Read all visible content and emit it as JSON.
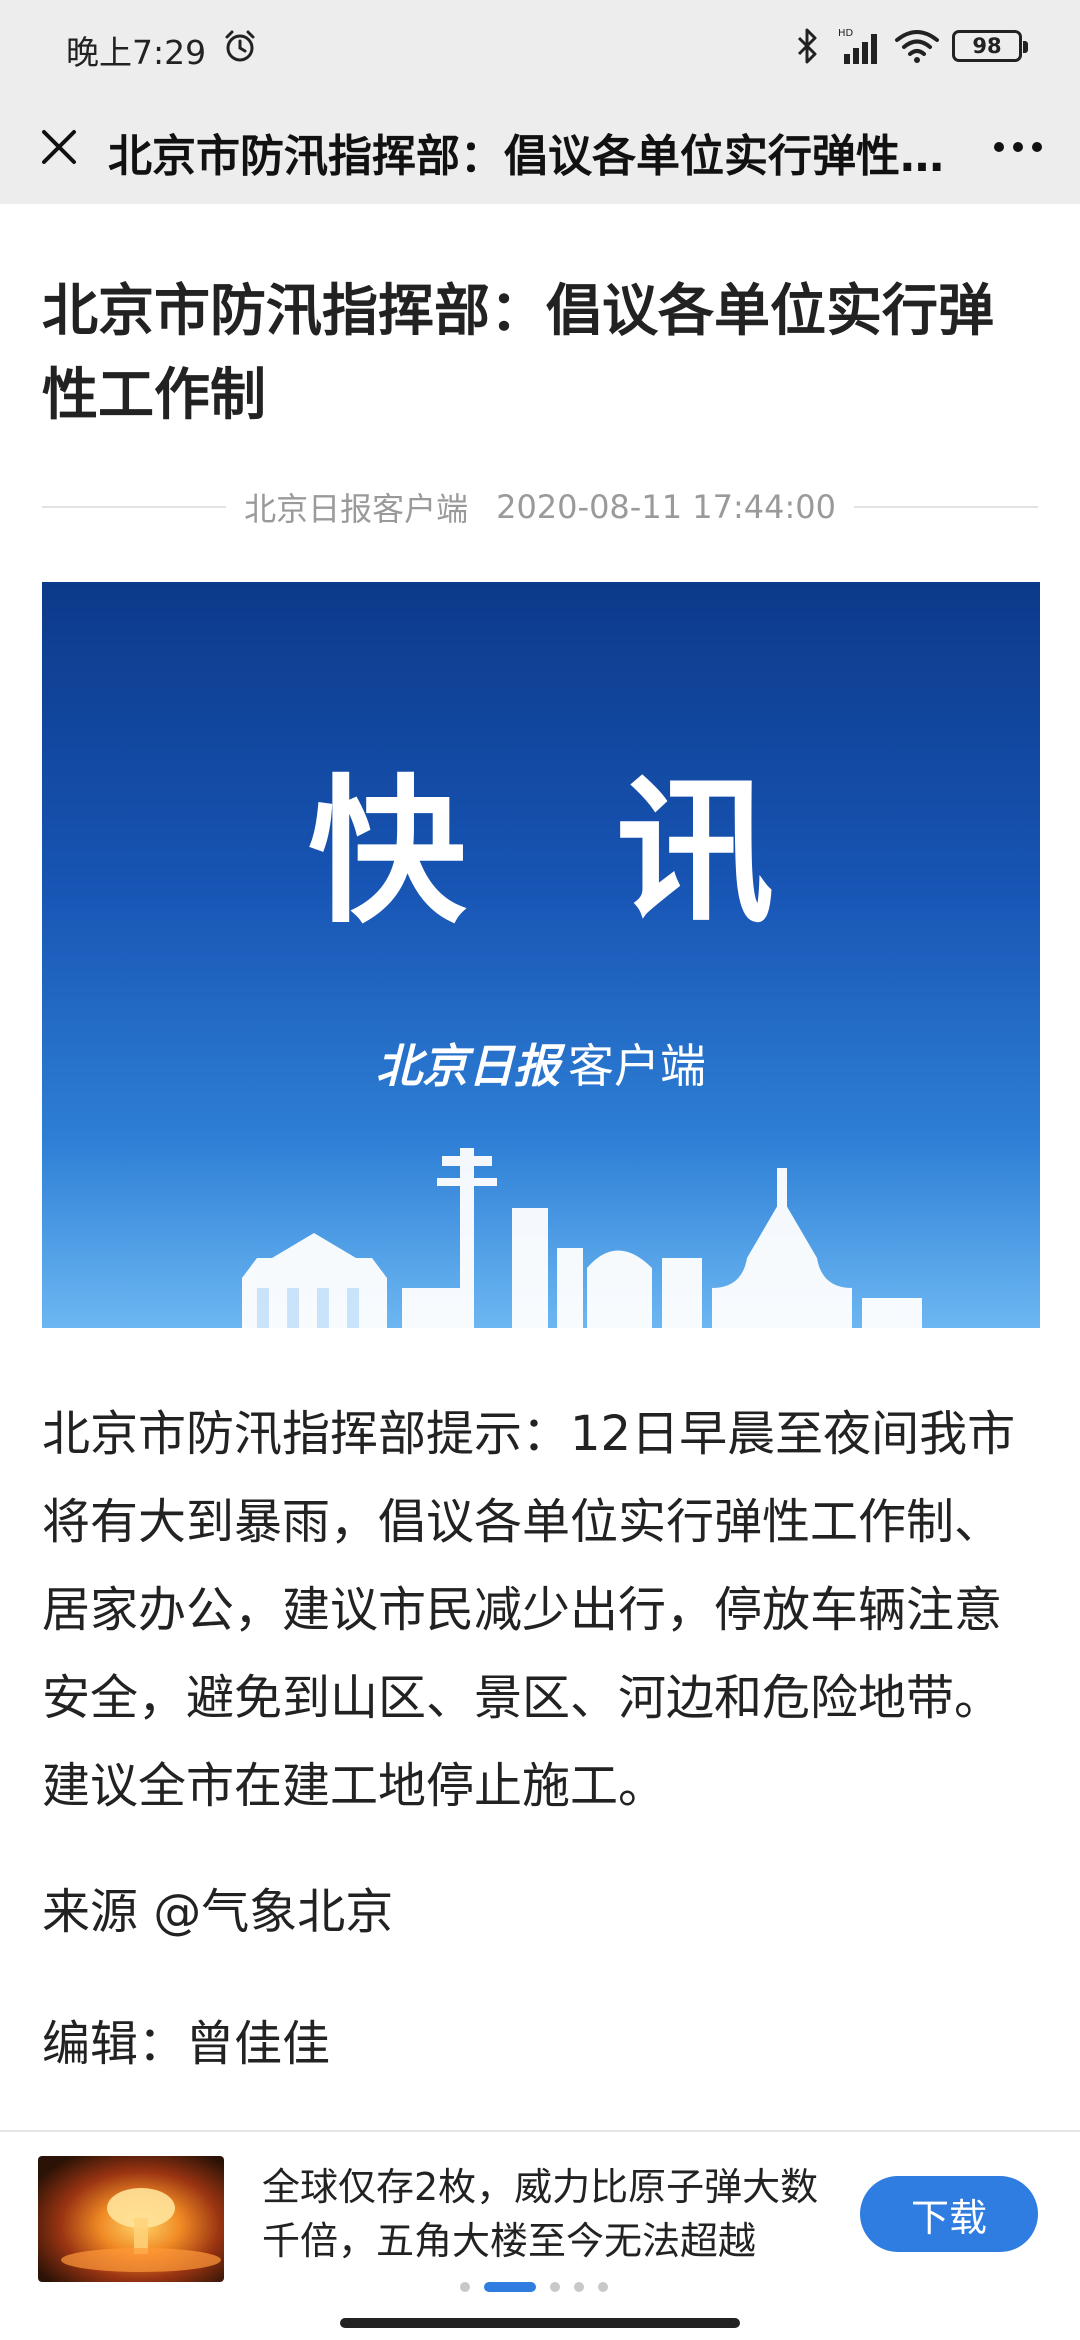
{
  "status_bar": {
    "time": "晚上7:29",
    "battery_level": "98",
    "icons": [
      "alarm-icon",
      "bluetooth-icon",
      "hd-signal-icon",
      "wifi-icon",
      "battery-icon"
    ]
  },
  "nav": {
    "title": "北京市防汛指挥部：倡议各单位实行弹性工作制",
    "close_icon": "close-icon",
    "more_icon": "more-icon"
  },
  "article": {
    "title": "北京市防汛指挥部：倡议各单位实行弹性工作制",
    "source": "北京日报客户端",
    "published_at": "2020-08-11 17:44:00",
    "hero": {
      "headline": "快讯",
      "brand_script": "北京日报",
      "brand_suffix": "客户端",
      "colors": [
        "#0c3a8a",
        "#2e7fd6",
        "#6cb7f2"
      ]
    },
    "body": "北京市防汛指挥部提示：12日早晨至夜间我市将有大到暴雨，倡议各单位实行弹性工作制、居家办公，建议市民减少出行，停放车辆注意安全，避免到山区、景区、河边和危险地带。建议全市在建工地停止施工。",
    "credit_source": "来源 @气象北京",
    "editor": "编辑：曾佳佳"
  },
  "ad": {
    "text": "全球仅存2枚，威力比原子弹大数千倍，五角大楼至今无法超越",
    "download_label": "下载",
    "carousel_active_index": 1,
    "carousel_count": 5,
    "accent_color": "#2f7de1"
  }
}
